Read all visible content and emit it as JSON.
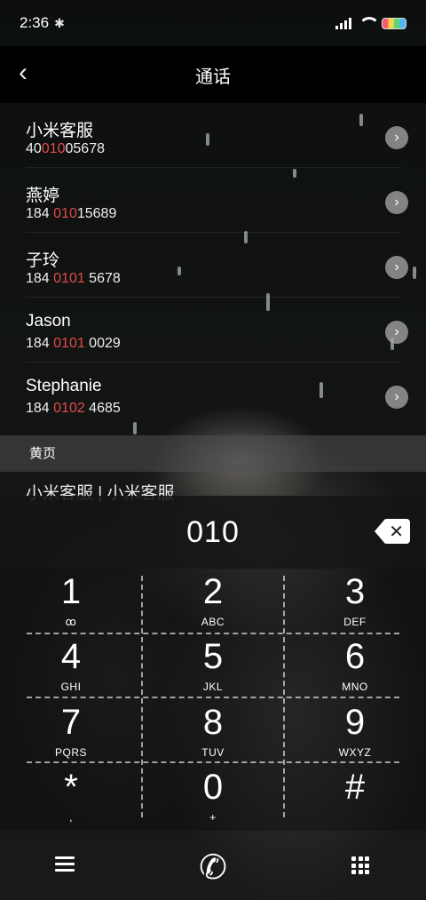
{
  "status_bar": {
    "time": "2:36",
    "bluetooth_icon": "bluetooth-icon",
    "signal_icon": "signal-icon",
    "wifi_icon": "wifi-icon",
    "battery_icon": "battery-icon"
  },
  "header": {
    "back_icon": "‹",
    "title": "通话"
  },
  "results": [
    {
      "name": "小米客服",
      "num_pre": "40",
      "num_hl": "010",
      "num_post": "05678"
    },
    {
      "name": "燕婷",
      "num_pre": "184 ",
      "num_hl": "010",
      "num_post": "15689"
    },
    {
      "name": "子玲",
      "num_pre": "184 ",
      "num_hl": "0101",
      "num_post": " 5678"
    },
    {
      "name": "Jason",
      "num_pre": "184 ",
      "num_hl": "0101",
      "num_post": " 0029"
    },
    {
      "name": "Stephanie",
      "num_pre": "184 ",
      "num_hl": "0102",
      "num_post": " 4685"
    }
  ],
  "section_label": "黄页",
  "partial_row": "小米客服 | 小米客服",
  "dialer": {
    "number": "010",
    "keys": [
      {
        "digit": "1",
        "letters": "ꝏ"
      },
      {
        "digit": "2",
        "letters": "ABC"
      },
      {
        "digit": "3",
        "letters": "DEF"
      },
      {
        "digit": "4",
        "letters": "GHI"
      },
      {
        "digit": "5",
        "letters": "JKL"
      },
      {
        "digit": "6",
        "letters": "MNO"
      },
      {
        "digit": "7",
        "letters": "PQRS"
      },
      {
        "digit": "8",
        "letters": "TUV"
      },
      {
        "digit": "9",
        "letters": "WXYZ"
      },
      {
        "digit": "*",
        "letters": ","
      },
      {
        "digit": "0",
        "letters": "+"
      },
      {
        "digit": "#",
        "letters": ""
      }
    ]
  },
  "bottom_bar": {
    "menu_icon": "menu-icon",
    "call_icon": "✆",
    "keypad_icon": "keypad-icon"
  },
  "colors": {
    "highlight": "#e24b4b",
    "background": "#000000"
  }
}
